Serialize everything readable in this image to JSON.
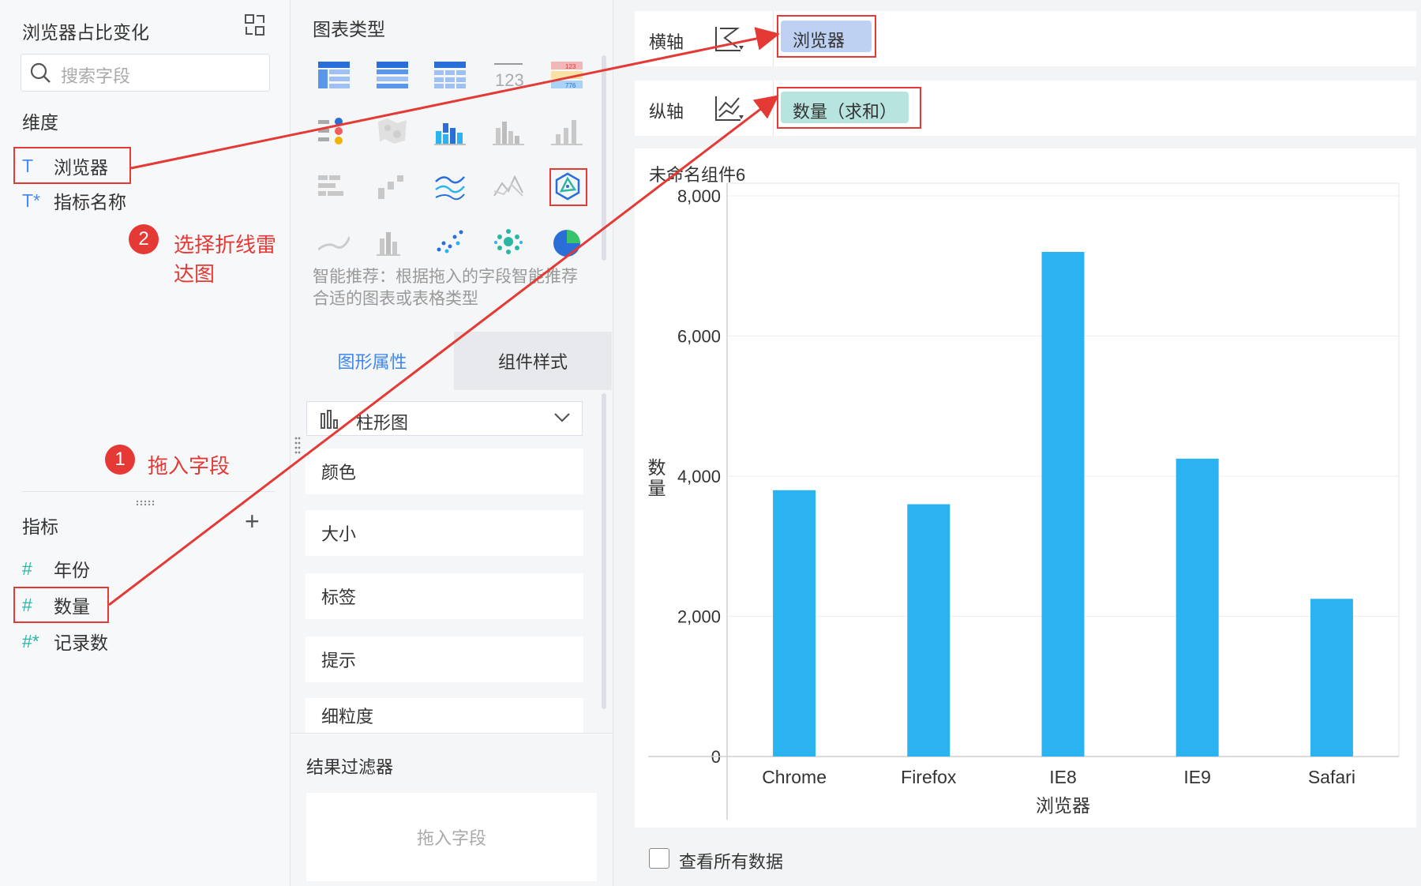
{
  "left_panel": {
    "title": "浏览器占比变化",
    "search_placeholder": "搜索字段",
    "dimensions_title": "维度",
    "dimensions": [
      {
        "icon": "T",
        "label": "浏览器"
      },
      {
        "icon": "T*",
        "label": "指标名称"
      }
    ],
    "metrics_title": "指标",
    "metrics": [
      {
        "icon": "#",
        "label": "年份"
      },
      {
        "icon": "#",
        "label": "数量"
      },
      {
        "icon": "#*",
        "label": "记录数"
      }
    ]
  },
  "middle_panel": {
    "chart_types_title": "图表类型",
    "smart_recommend": "智能推荐：根据拖入的字段智能推荐合适的图表或表格类型",
    "tabs": [
      "图形属性",
      "组件样式"
    ],
    "active_tab": "图形属性",
    "chart_type_select": "柱形图",
    "properties": [
      "颜色",
      "大小",
      "标签",
      "提示",
      "细粒度"
    ],
    "result_filter_title": "结果过滤器",
    "drop_field_placeholder": "拖入字段"
  },
  "axes": {
    "x_label": "横轴",
    "x_field": "浏览器",
    "y_label": "纵轴",
    "y_field": "数量（求和）"
  },
  "annotations": {
    "step1_number": "1",
    "step1_text": "拖入字段",
    "step2_number": "2",
    "step2_text": "选择折线雷达图"
  },
  "chart_data": {
    "type": "bar",
    "title": "未命名组件6",
    "xlabel": "浏览器",
    "ylabel": "数量",
    "categories": [
      "Chrome",
      "Firefox",
      "IE8",
      "IE9",
      "Safari"
    ],
    "values": [
      3800,
      3600,
      7200,
      4250,
      2250
    ],
    "ylim": [
      0,
      8000
    ],
    "yticks": [
      "0",
      "2,000",
      "4,000",
      "6,000",
      "8,000"
    ],
    "color": "#2ab3f0",
    "grid": true
  },
  "footer": {
    "view_all_label": "查看所有数据"
  },
  "colors": {
    "accent": "#3d86f4",
    "annotation_red": "#e53935",
    "bar": "#2ab3f0"
  }
}
